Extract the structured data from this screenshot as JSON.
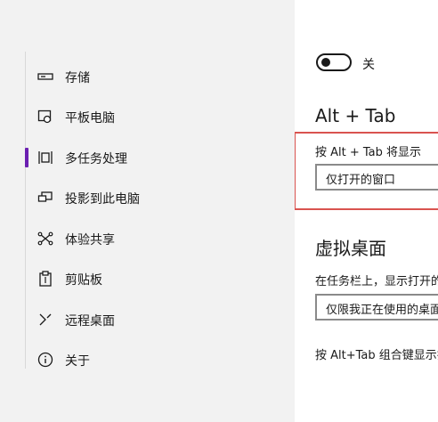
{
  "sidebar": {
    "items": [
      {
        "label": "存储",
        "icon": "storage-icon"
      },
      {
        "label": "平板电脑",
        "icon": "tablet-icon"
      },
      {
        "label": "多任务处理",
        "icon": "multitasking-icon",
        "selected": true
      },
      {
        "label": "投影到此电脑",
        "icon": "project-icon"
      },
      {
        "label": "体验共享",
        "icon": "share-icon"
      },
      {
        "label": "剪贴板",
        "icon": "clipboard-icon"
      },
      {
        "label": "远程桌面",
        "icon": "remote-desktop-icon"
      },
      {
        "label": "关于",
        "icon": "info-icon"
      }
    ],
    "accent_color": "#6b1fb1"
  },
  "main": {
    "toggle": {
      "state": "关"
    },
    "alt_tab": {
      "title": "Alt + Tab",
      "label": "按 Alt + Tab 将显示",
      "value": "仅打开的窗口"
    },
    "virtual_desktops": {
      "title": "虚拟桌面",
      "taskbar_label": "在任务栏上，显示打开的",
      "taskbar_value": "仅限我正在使用的桌面",
      "alt_tab_label": "按 Alt+Tab 组合键显示打"
    },
    "highlight_color": "#d9534f"
  }
}
